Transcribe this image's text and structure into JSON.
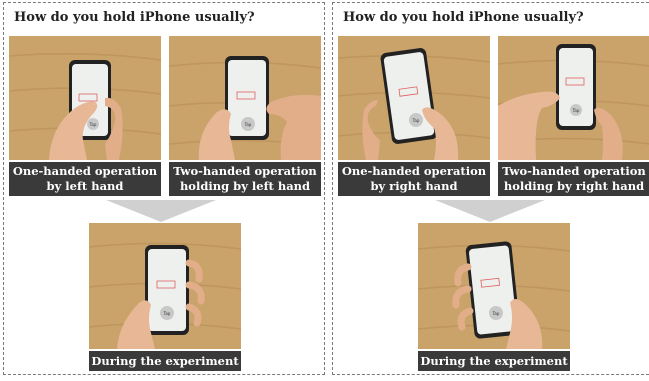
{
  "panels": [
    {
      "question": "How do you hold iPhone usually?",
      "options": [
        {
          "line1": "One-handed operation",
          "line2": "by left hand"
        },
        {
          "line1": "Two-handed operation",
          "line2": "holding by left hand"
        }
      ],
      "result": {
        "label": "During the experiment"
      }
    },
    {
      "question": "How do you hold iPhone usually?",
      "options": [
        {
          "line1": "One-handed operation",
          "line2": "by right hand"
        },
        {
          "line1": "Two-handed operation",
          "line2": "holding by right hand"
        }
      ],
      "result": {
        "label": "During the experiment"
      }
    }
  ],
  "phone_screen": {
    "tap_label": "Tap"
  },
  "colors": {
    "wood": "#c9a36a",
    "caption_bg": "#3a3a3a",
    "arrow": "#d0d0d0",
    "skin": "#e8b896"
  }
}
